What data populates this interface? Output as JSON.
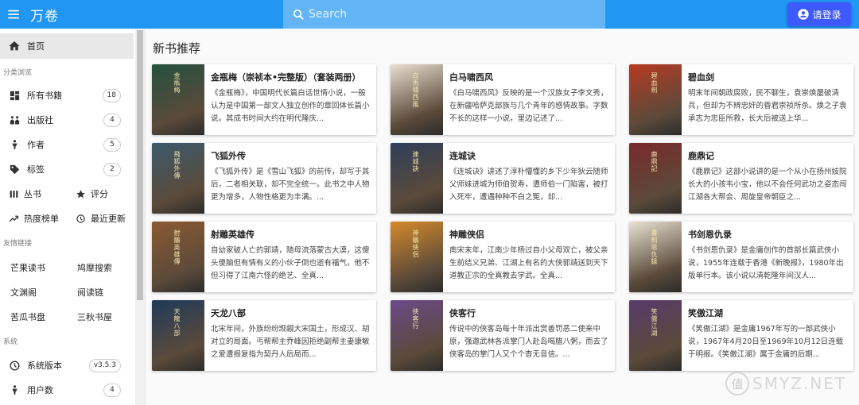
{
  "appbar": {
    "title": "万卷",
    "search_placeholder": "Search",
    "login_label": "请登录"
  },
  "sidebar": {
    "home_label": "首页",
    "section_browse": "分类浏览",
    "browse_items": [
      {
        "label": "所有书籍",
        "count": "18"
      },
      {
        "label": "出版社",
        "count": "4"
      },
      {
        "label": "作者",
        "count": "5"
      },
      {
        "label": "标签",
        "count": "2"
      }
    ],
    "pairs": [
      {
        "left": "丛书",
        "right": "评分"
      },
      {
        "left": "热度榜单",
        "right": "最近更新"
      }
    ],
    "section_links": "友情链接",
    "links": [
      "芒果读书",
      "鸠摩搜索",
      "文渊阁",
      "阅读链",
      "苦瓜书盘",
      "三秋书屋"
    ],
    "section_system": "系统",
    "system_items": [
      {
        "label": "系统版本",
        "count": "v3.5.3"
      },
      {
        "label": "用户数",
        "count": "4"
      }
    ]
  },
  "main": {
    "title": "新书推荐",
    "books": [
      {
        "title": "金瓶梅（崇祯本•完整版）（套装两册）",
        "desc": "《金瓶梅》，中国明代长篇白话世情小说，一般认为是中国第一部文人独立创作的章回体长篇小说。其成书时间大约在明代隆庆...",
        "cover_text": "金瓶梅",
        "cover_color": "#24503f"
      },
      {
        "title": "白马啸西风",
        "desc": "《白马啸西风》反映的是一个汉族女子李文秀，在新疆哈萨克部族与几个青年的感情故事。字数不长的这样一小说，里边记述了...",
        "cover_text": "白馬嘯西風",
        "cover_color": "#e9dfd0"
      },
      {
        "title": "碧血剑",
        "desc": "明末年间朝政腐败，民不聊生，袁崇焕屡破清兵，但却为不辨忠奸的昏君崇祯所杀。焕之子袁承志为忠臣所救，长大后被送上华...",
        "cover_text": "碧血劍",
        "cover_color": "#b73a23"
      },
      {
        "title": "飞狐外传",
        "desc": "《飞狐外传》是《雪山飞狐》的前传，却写于其后，二者相关联，却不完全统一。此书之中人物更为增多，人物性格更为丰满。...",
        "cover_text": "飛狐外傳",
        "cover_color": "#3b5a6b"
      },
      {
        "title": "连城诀",
        "desc": "《连城诀》讲述了淳朴懵懂的乡下少年狄云随师父师妹进城为师伯贺寿，遭师伯一门陷害，被打入死牢，遭遇种种不白之冤，却...",
        "cover_text": "連城訣",
        "cover_color": "#2f3f5a"
      },
      {
        "title": "鹿鼎记",
        "desc": "《鹿鼎记》这部小说讲的是一个从小在扬州妓院长大的小孩韦小宝，他以不会任何武功之姿态闯江湖各大帮会、周旋皇帝朝臣之...",
        "cover_text": "鹿鼎記",
        "cover_color": "#7a2a2a"
      },
      {
        "title": "射雕英雄传",
        "desc": "自幼家破人亡的郭靖，随母流落蒙古大漠，这傻头傻脑但有情有义的小伙子倒也逝有福气，他不但习得了江南六怪的绝艺、全真...",
        "cover_text": "射鵰英雄傳",
        "cover_color": "#8a5a32"
      },
      {
        "title": "神雕侠侣",
        "desc": "南宋末年，江南少年杨过自小父母双亡，被父亲生前结义兄弟、江湖上有名的大侠郭靖送到天下道教正宗的全真教去学武。全真...",
        "cover_text": "神鵰俠侶",
        "cover_color": "#d48a2a"
      },
      {
        "title": "书剑恩仇录",
        "desc": "《书剑恩仇录》是金庸创作的首部长篇武侠小说，1955年连载于香港《新晚报》，1980年出版单行本。该小说以清乾隆年间汉人...",
        "cover_text": "書劍恩仇錄",
        "cover_color": "#e8e2d2"
      },
      {
        "title": "天龙八部",
        "desc": "北宋年间，外族纷纷觊觎大宋国土，形成汉、胡对立的局面。丐帮帮主乔峰因拒绝副帮主妻康敏之爱遭报复指为契丹人后局而...",
        "cover_text": "天龍八部",
        "cover_color": "#1f3a5a"
      },
      {
        "title": "侠客行",
        "desc": "传说中的侠客岛每十年派出赏善罚恶二使来中原，强邀武林各派掌门人赴岛喝腊八粥，而去了侠客岛的掌门人又个个杳无音信。...",
        "cover_text": "俠客行",
        "cover_color": "#6b4a8a"
      },
      {
        "title": "笑傲江湖",
        "desc": "《笑傲江湖》是金庸1967年写的一部武侠小说，1967年4月20日至1969年10月12日连载于明报。《笑傲江湖》属于金庸的后期...",
        "cover_text": "笑傲江湖",
        "cover_color": "#5a3a6b"
      }
    ]
  },
  "watermark": {
    "text": "SMYZ.NET",
    "logo": "值"
  }
}
